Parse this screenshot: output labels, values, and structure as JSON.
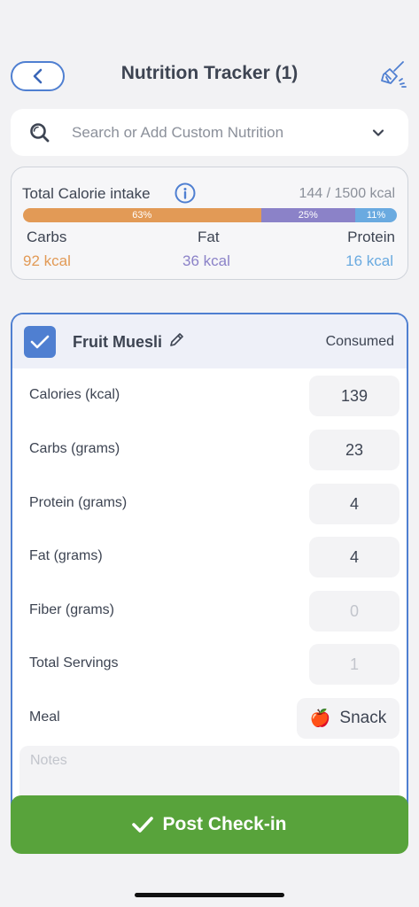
{
  "header": {
    "title": "Nutrition Tracker (1)"
  },
  "search": {
    "placeholder": "Search or Add Custom Nutrition"
  },
  "calories": {
    "label": "Total Calorie intake",
    "total": "144 / 1500 kcal",
    "bar": [
      {
        "name": "carbs",
        "percent_label": "63%",
        "percent": 63
      },
      {
        "name": "fat",
        "percent_label": "25%",
        "percent": 25
      },
      {
        "name": "protein",
        "percent_label": "11%",
        "percent": 11
      }
    ],
    "macros": {
      "carbs": {
        "label": "Carbs",
        "value": "92 kcal"
      },
      "fat": {
        "label": "Fat",
        "value": "36 kcal"
      },
      "protein": {
        "label": "Protein",
        "value": "16 kcal"
      }
    }
  },
  "food": {
    "name": "Fruit Muesli",
    "status": "Consumed",
    "checked": true,
    "rows": [
      {
        "label": "Calories (kcal)",
        "value": "139",
        "muted": false
      },
      {
        "label": "Carbs (grams)",
        "value": "23",
        "muted": false
      },
      {
        "label": "Protein (grams)",
        "value": "4",
        "muted": false
      },
      {
        "label": "Fat (grams)",
        "value": "4",
        "muted": false
      },
      {
        "label": "Fiber (grams)",
        "value": "0",
        "muted": true
      },
      {
        "label": "Total Servings",
        "value": "1",
        "muted": true
      }
    ],
    "meal": {
      "label": "Meal",
      "emoji": "🍎",
      "value": "Snack"
    },
    "notes_placeholder": "Notes"
  },
  "actions": {
    "post_label": "Post Check-in"
  },
  "colors": {
    "accent": "#4f7fd1",
    "carbs": "#e29a56",
    "fat": "#8b82c8",
    "protein": "#6aaae0",
    "post_button": "#58a33b"
  }
}
